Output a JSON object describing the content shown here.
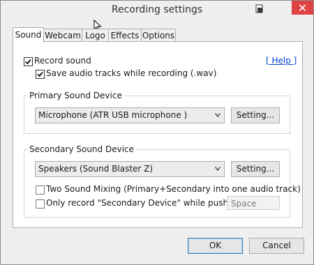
{
  "window": {
    "title": "Recording settings",
    "close_glyph": "✕",
    "accent": "#e04343"
  },
  "tabs": [
    {
      "label": "Sound",
      "active": true
    },
    {
      "label": "Webcam",
      "active": false
    },
    {
      "label": "Logo",
      "active": false
    },
    {
      "label": "Effects",
      "active": false
    },
    {
      "label": "Options",
      "active": false
    }
  ],
  "sound": {
    "record_sound": {
      "label": "Record sound",
      "checked": true
    },
    "save_wav": {
      "label": "Save audio tracks while recording (.wav)",
      "checked": true
    },
    "help_link": "[ Help ]",
    "primary": {
      "group_title": "Primary Sound Device",
      "device": "Microphone (ATR USB microphone )",
      "setting_button": "Setting..."
    },
    "secondary": {
      "group_title": "Secondary Sound Device",
      "device": "Speakers (Sound Blaster Z)",
      "setting_button": "Setting...",
      "two_mixing": {
        "label": "Two Sound Mixing (Primary+Secondary into one audio track)",
        "checked": false
      },
      "only_secondary": {
        "label": "Only record \"Secondary Device\" while pushing",
        "checked": false
      },
      "hotkey": "Space"
    }
  },
  "footer": {
    "ok": "OK",
    "cancel": "Cancel"
  }
}
